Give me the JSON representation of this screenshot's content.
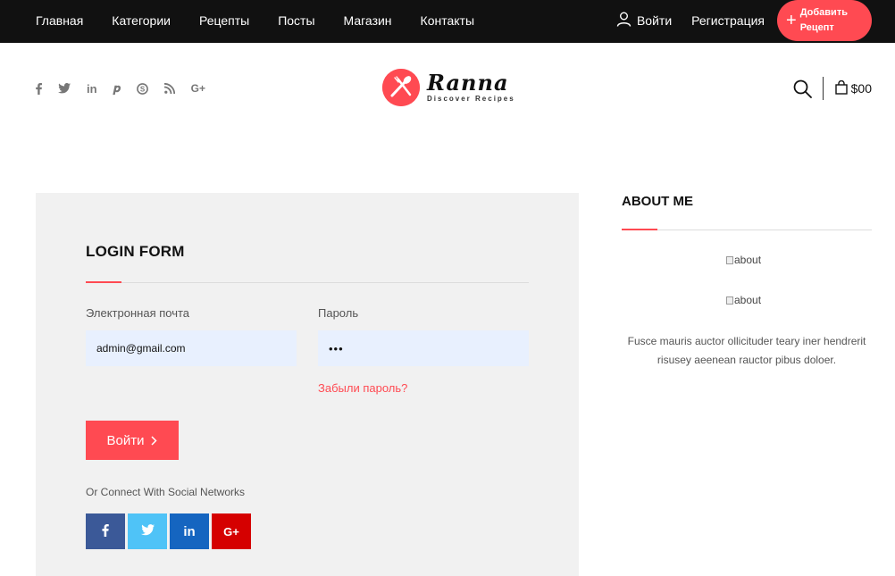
{
  "nav": {
    "items": [
      "Главная",
      "Категории",
      "Рецепты",
      "Посты",
      "Магазин",
      "Контакты"
    ],
    "login_label": "Войти",
    "register_label": "Регистрация",
    "add_recipe_line1": "Добавить",
    "add_recipe_line2": "Рецепт"
  },
  "header": {
    "social_icons": [
      "facebook-icon",
      "twitter-icon",
      "linkedin-icon",
      "pinterest-icon",
      "skype-icon",
      "rss-icon",
      "google-plus-icon"
    ],
    "logo_name": "Ranna",
    "logo_tagline": "Discover Recipes",
    "cart_total": "$00"
  },
  "login": {
    "title": "LOGIN FORM",
    "email_label": "Электронная почта",
    "email_value": "admin@gmail.com",
    "password_label": "Пароль",
    "password_value": "•••",
    "forgot_label": "Забыли пароль?",
    "submit_label": "Войти",
    "connect_text": "Or Connect With Social Networks",
    "social_buttons": [
      {
        "label": "f",
        "icon": "facebook-icon",
        "color": "#3b5998"
      },
      {
        "label": "t",
        "icon": "twitter-icon",
        "color": "#4fc3f7"
      },
      {
        "label": "in",
        "icon": "linkedin-icon",
        "color": "#1565c0"
      },
      {
        "label": "G+",
        "icon": "google-plus-icon",
        "color": "#d50000"
      }
    ]
  },
  "about": {
    "title": "ABOUT ME",
    "image_alt_1": "about",
    "image_alt_2": "about",
    "text": "Fusce mauris auctor ollicituder teary iner hendrerit risusey aeenean rauctor pibus doloer."
  },
  "colors": {
    "accent": "#ff4a52",
    "topbar": "#111111",
    "panel": "#f1f1f1",
    "input_fill": "#e8f0fe"
  }
}
